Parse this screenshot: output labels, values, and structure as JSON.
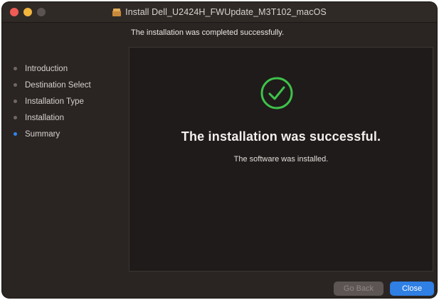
{
  "window": {
    "title": "Install Dell_U2424H_FWUpdate_M3T102_macOS"
  },
  "status_text": "The installation was completed successfully.",
  "sidebar": {
    "items": [
      {
        "label": "Introduction",
        "active": false
      },
      {
        "label": "Destination Select",
        "active": false
      },
      {
        "label": "Installation Type",
        "active": false
      },
      {
        "label": "Installation",
        "active": false
      },
      {
        "label": "Summary",
        "active": true
      }
    ]
  },
  "main": {
    "headline": "The installation was successful.",
    "subline": "The software was installed."
  },
  "buttons": {
    "go_back": "Go Back",
    "close": "Close"
  },
  "colors": {
    "accent": "#2f7fe4",
    "success": "#3ec24a",
    "window_bg": "#2a2523",
    "panel_bg": "#1f1b1a"
  },
  "icons": {
    "success": "check-circle-icon",
    "package": "package-icon"
  }
}
